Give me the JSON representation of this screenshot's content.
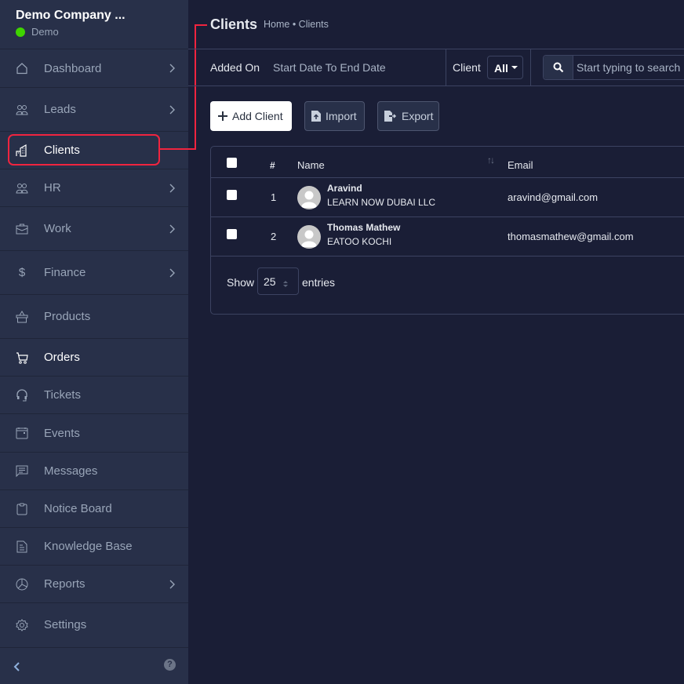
{
  "company": {
    "name": "Demo Company ...",
    "workspace": "Demo",
    "status_color": "#3fd400"
  },
  "sidebar": {
    "items": [
      {
        "label": "Dashboard",
        "icon": "home-icon",
        "has_submenu": true
      },
      {
        "label": "Leads",
        "icon": "users-icon",
        "has_submenu": true
      },
      {
        "label": "Clients",
        "icon": "building-icon",
        "has_submenu": false,
        "active": true
      },
      {
        "label": "HR",
        "icon": "users-icon",
        "has_submenu": true
      },
      {
        "label": "Work",
        "icon": "briefcase-icon",
        "has_submenu": true
      },
      {
        "label": "Finance",
        "icon": "dollar-icon",
        "has_submenu": true
      },
      {
        "label": "Products",
        "icon": "basket-icon",
        "has_submenu": false
      },
      {
        "label": "Orders",
        "icon": "cart-icon",
        "has_submenu": false
      },
      {
        "label": "Tickets",
        "icon": "headset-icon",
        "has_submenu": false
      },
      {
        "label": "Events",
        "icon": "calendar-icon",
        "has_submenu": false
      },
      {
        "label": "Messages",
        "icon": "message-icon",
        "has_submenu": false
      },
      {
        "label": "Notice Board",
        "icon": "clipboard-icon",
        "has_submenu": false
      },
      {
        "label": "Knowledge Base",
        "icon": "document-icon",
        "has_submenu": false
      },
      {
        "label": "Reports",
        "icon": "pie-chart-icon",
        "has_submenu": true
      },
      {
        "label": "Settings",
        "icon": "gear-icon",
        "has_submenu": false
      }
    ],
    "help_label": "?"
  },
  "header": {
    "title": "Clients",
    "breadcrumb": "Home • Clients"
  },
  "filters": {
    "added_on_label": "Added On",
    "date_range": "Start Date To End Date",
    "client_label": "Client",
    "client_value": "All",
    "search_placeholder": "Start typing to search"
  },
  "actions": {
    "add": "Add Client",
    "import": "Import",
    "export": "Export"
  },
  "table": {
    "columns": [
      "#",
      "Name",
      "Email"
    ],
    "rows": [
      {
        "id": "1",
        "name": "Aravind",
        "company": "LEARN NOW DUBAI LLC",
        "email": "aravind@gmail.com"
      },
      {
        "id": "2",
        "name": "Thomas Mathew",
        "company": "EATOO KOCHI",
        "email": "thomasmathew@gmail.com"
      }
    ],
    "show_label": "Show",
    "page_size": "25",
    "entries_label": "entries"
  },
  "colors": {
    "highlight": "#f0243f",
    "sidebar_bg": "#283049",
    "main_bg": "#1a1e36"
  }
}
